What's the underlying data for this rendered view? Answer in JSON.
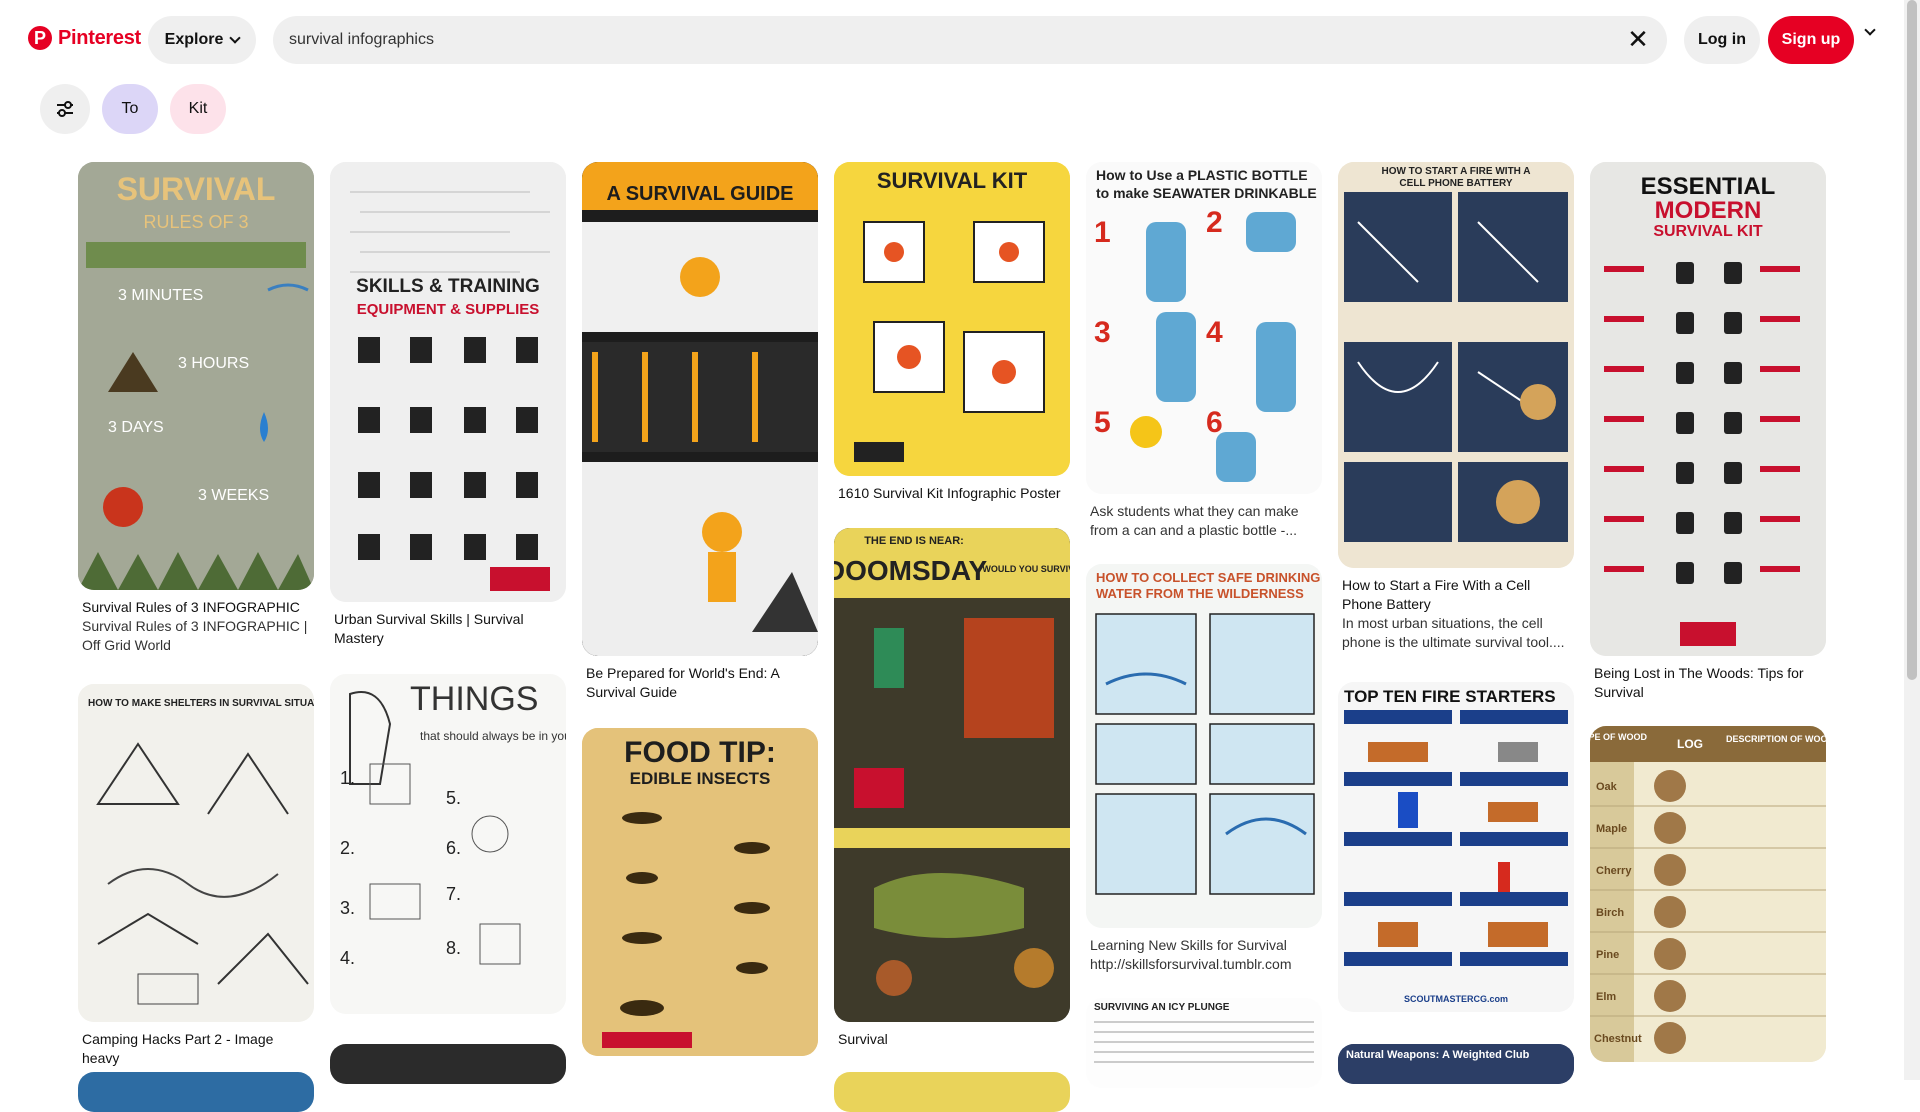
{
  "header": {
    "logo_text": "Pinterest",
    "explore_label": "Explore",
    "search_value": "survival infographics",
    "login_label": "Log in",
    "signup_label": "Sign up"
  },
  "filters": {
    "chips": [
      "To",
      "Kit"
    ]
  },
  "pins": [
    {
      "title": "Survival Rules of 3 INFOGRAPHIC",
      "desc": "Survival Rules of 3 INFOGRAPHIC | Off Grid World",
      "overlay": "SURVIVAL",
      "overlay2": "RULES OF 3"
    },
    {
      "title": "Urban Survival Skills | Survival Mastery",
      "overlay": "SKILLS & TRAINING",
      "overlay2": "EQUIPMENT & SUPPLIES"
    },
    {
      "title": "Be Prepared for World's End: A Survival Guide",
      "overlay": "A SURVIVAL GUIDE"
    },
    {
      "title": "1610 Survival Kit Infographic Poster",
      "overlay": "SURVIVAL KIT"
    },
    {
      "desc": "Ask students what they can make from a can and a plastic bottle -...",
      "overlay": "How to Use a PLASTIC BOTTLE",
      "overlay2": "to make SEAWATER DRINKABLE"
    },
    {
      "title": "How to Start a Fire With a Cell Phone Battery",
      "desc": "In most urban situations, the cell phone is the ultimate survival tool....",
      "overlay": "HOW TO START A FIRE WITH A",
      "overlay2": "CELL PHONE BATTERY"
    },
    {
      "title": "Being Lost in The Woods: Tips for Survival",
      "overlay": "ESSENTIAL",
      "overlay2": "MODERN",
      "overlay3": "SURVIVAL KIT"
    },
    {
      "title": "Camping Hacks Part 2 - Image heavy",
      "overlay": "HOW TO MAKE SHELTERS IN SURVIVAL SITUATIONS"
    },
    {
      "overlay": "THINGS",
      "overlay2": "that should always be in your bag"
    },
    {
      "overlay": "FOOD TIP:",
      "overlay2": "EDIBLE INSECTS"
    },
    {
      "title": "Survival",
      "overlay": "THE END IS NEAR:",
      "overlay2": "DOOMSDAY",
      "overlay3": "WOULD YOU SURVIVE?"
    },
    {
      "desc": "Learning New Skills for Survival http://skillsforsurvival.tumblr.com",
      "overlay": "HOW TO COLLECT SAFE DRINKING",
      "overlay2": "WATER FROM THE WILDERNESS"
    },
    {
      "overlay": "TOP TEN FIRE STARTERS"
    },
    {
      "overlay": "TYPE OF WOOD",
      "overlay2": "LOG",
      "overlay3": "DESCRIPTION OF WOOD"
    },
    {
      "overlay": "SURVIVING AN ICY PLUNGE"
    },
    {
      "overlay": "Natural Weapons: A Weighted Club"
    }
  ]
}
